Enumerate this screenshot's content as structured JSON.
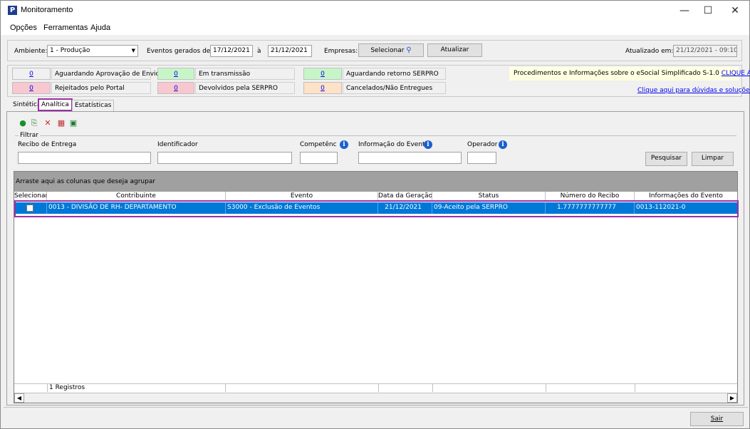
{
  "window": {
    "title": "Monitoramento",
    "app_icon": "P",
    "min": "—",
    "max": "☐",
    "close": "✕"
  },
  "menu": [
    "Opções",
    "Ferramentas",
    "Ajuda"
  ],
  "filterbar": {
    "ambiente_label": "Ambiente:",
    "ambiente_value": "1 - Produção",
    "eventos_label": "Eventos gerados de:",
    "date_from": "17/12/2021",
    "a_label": "à",
    "date_to": "21/12/2021",
    "empresas_label": "Empresas:",
    "selecionar_label": "Selecionar",
    "atualizar_label": "Atualizar",
    "atualizado_label": "Atualizado em:",
    "atualizado_value": "21/12/2021 - 09:10"
  },
  "status": [
    {
      "count": "0",
      "label": "Aguardando Aprovação de Envio",
      "color": "#f0f0f0"
    },
    {
      "count": "0",
      "label": "Em transmissão",
      "color": "#c8f5c8"
    },
    {
      "count": "0",
      "label": "Aguardando retorno SERPRO",
      "color": "#c8f5c8"
    },
    {
      "count": "0",
      "label": "Rejeitados pelo Portal",
      "color": "#f8c8d0"
    },
    {
      "count": "0",
      "label": "Devolvidos pela SERPRO",
      "color": "#f8c8d0"
    },
    {
      "count": "0",
      "label": "Cancelados/Não Entregues",
      "color": "#fde2c8"
    }
  ],
  "notice": {
    "text": "Procedimentos e Informações sobre o eSocial Simplificado S-1.0",
    "link": "CLIQUE AQUI",
    "help_link": "Clique aqui para dúvidas e soluções"
  },
  "tabs": [
    "Sintética",
    "Analítica",
    "Estatísticas"
  ],
  "toolbar_icons": [
    "globe-icon",
    "export-icon",
    "delete-icon",
    "calendar-icon",
    "excel-icon"
  ],
  "filters": {
    "group_label": "Filtrar",
    "recibo_label": "Recibo de Entrega",
    "identificador_label": "Identificador",
    "competencia_label": "Competênc",
    "informacao_label": "Informação do Evento",
    "operador_label": "Operador",
    "pesquisar": "Pesquisar",
    "limpar": "Limpar"
  },
  "grid": {
    "group_hint": "Arraste aqui as colunas que deseja agrupar",
    "columns": [
      "Selecionar",
      "Contribuinte",
      "Evento",
      "Data da Geração",
      "Status",
      "Número do Recibo",
      "Informações do Evento"
    ],
    "rows": [
      {
        "contribuinte": "0013 - DIVISÃO DE RH- DEPARTAMENTO",
        "evento": "S3000 - Exclusão de Eventos",
        "data": "21/12/2021",
        "status": "09-Aceito pela SERPRO",
        "recibo": "1.7777777777777",
        "info": "0013-112021-0"
      }
    ],
    "footer": "1 Registros"
  },
  "sair": "Sair"
}
